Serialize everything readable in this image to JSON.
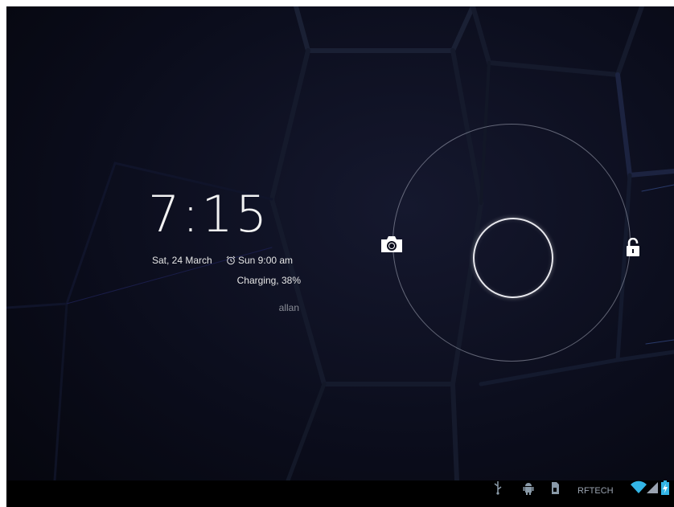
{
  "lockscreen": {
    "time": "7:15",
    "date": "Sat, 24 March",
    "alarm": "Sun 9:00 am",
    "charging": "Charging, 38%",
    "owner": "allan"
  },
  "unlock": {
    "left_target_icon": "camera-icon",
    "right_target_icon": "unlock-icon",
    "center_icon": "unlock-handle"
  },
  "statusbar": {
    "carrier": "RFTECH",
    "icons": [
      "usb-icon",
      "android-debug-icon",
      "sd-card-icon",
      "wifi-icon",
      "signal-icon",
      "battery-charging-icon"
    ]
  },
  "colors": {
    "background": "#0b0d1c",
    "accent": "#33b5e5",
    "text": "#e6e6e6"
  }
}
